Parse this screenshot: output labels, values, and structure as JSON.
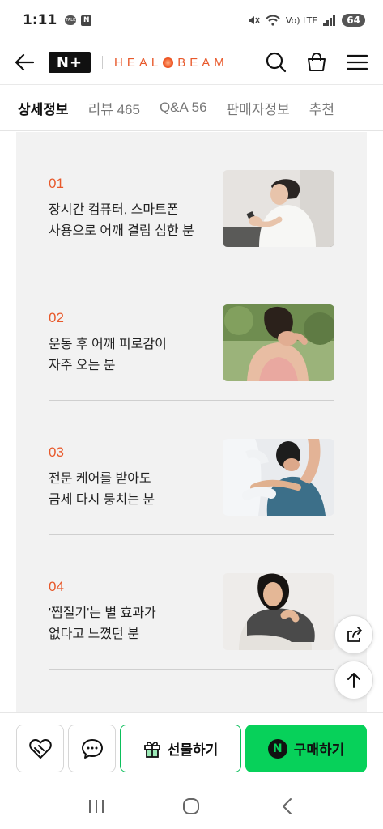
{
  "status_bar": {
    "time": "1:11",
    "talk_icon_text": "TALK",
    "n_icon_text": "N",
    "signal_text": "Vo) LTE",
    "battery": "64"
  },
  "header": {
    "logo_text": "N+",
    "brand_left": "HEAL",
    "brand_right": "BEAM",
    "brand_color": "#e8592b"
  },
  "tabs": [
    {
      "label": "상세정보",
      "active": true
    },
    {
      "label": "리뷰 465",
      "active": false
    },
    {
      "label": "Q&A 56",
      "active": false
    },
    {
      "label": "판매자정보",
      "active": false
    },
    {
      "label": "추천",
      "active": false
    }
  ],
  "items": [
    {
      "num": "01",
      "text": "장시간 컴퓨터, 스마트폰\n사용으로 어깨 결림 심한 분",
      "image": "woman-using-smartphone"
    },
    {
      "num": "02",
      "text": "운동 후 어깨 피로감이\n자주 오는 분",
      "image": "woman-rubbing-shoulder-outdoors"
    },
    {
      "num": "03",
      "text": "전문 케어를 받아도\n금세 다시 뭉치는 분",
      "image": "therapist-treating-shoulder"
    },
    {
      "num": "04",
      "text": "'찜질기'는 별 효과가\n없다고 느꼈던 분",
      "image": "woman-with-heating-pad"
    }
  ],
  "bottom_bar": {
    "gift_label": "선물하기",
    "buy_label": "구매하기",
    "npay_text": "N",
    "buy_color": "#07d15a"
  },
  "icons": {
    "back": "arrow-left-icon",
    "search": "search-icon",
    "cart": "shopping-bag-icon",
    "menu": "hamburger-menu-icon",
    "share": "share-icon",
    "scroll_top": "arrow-up-icon",
    "wishlist": "heart-icon",
    "chat": "chat-bubble-icon",
    "gift": "gift-icon"
  }
}
